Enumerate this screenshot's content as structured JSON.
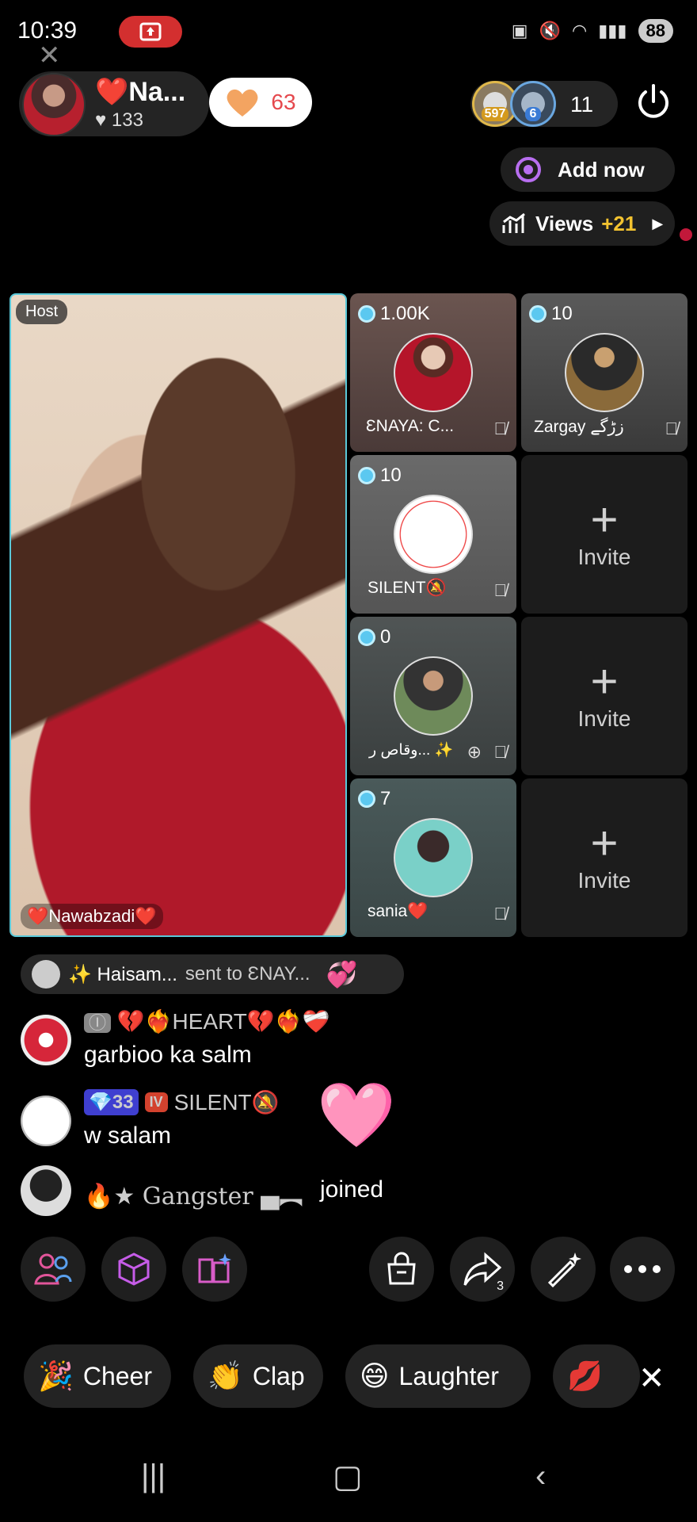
{
  "status": {
    "time": "10:39",
    "battery": "88"
  },
  "host": {
    "name": "❤️Na...",
    "likes": "♥ 133",
    "fav_count": "63",
    "badge": "Host",
    "display_name": "❤️Nawabzadi❤️"
  },
  "viewers": {
    "badge1": "597",
    "badge2": "6",
    "count": "11"
  },
  "actions": {
    "add_now": "Add now",
    "views_label": "Views",
    "views_delta": "+21"
  },
  "seats": [
    {
      "score": "1.00K",
      "name": "ƐNAYA: C..."
    },
    {
      "score": "10",
      "name": "Zargay زڑگے"
    },
    {
      "score": "10",
      "name": "SILENT🔕"
    },
    {
      "score": "0",
      "name": "وقاص ر... ✨"
    },
    {
      "score": "7",
      "name": "sania❤️"
    }
  ],
  "invite": {
    "label": "Invite"
  },
  "chat": {
    "gift": {
      "sender": "✨ Haisam...",
      "text": "sent to ƐNAY..."
    },
    "messages": [
      {
        "tag": "💔❤️‍🔥HEART💔❤️‍🔥❤️‍🩹",
        "text": "garbioo ka salm"
      },
      {
        "level": "33",
        "level2": "IV",
        "tag": "SILENT🔕",
        "text": "w salam"
      }
    ],
    "joined": {
      "name": "🔥★ Gangster ▄︻",
      "text": "joined"
    }
  },
  "toolbar": {
    "share_count": "3"
  },
  "reactions": [
    "Cheer",
    "Clap",
    "Laughter"
  ]
}
